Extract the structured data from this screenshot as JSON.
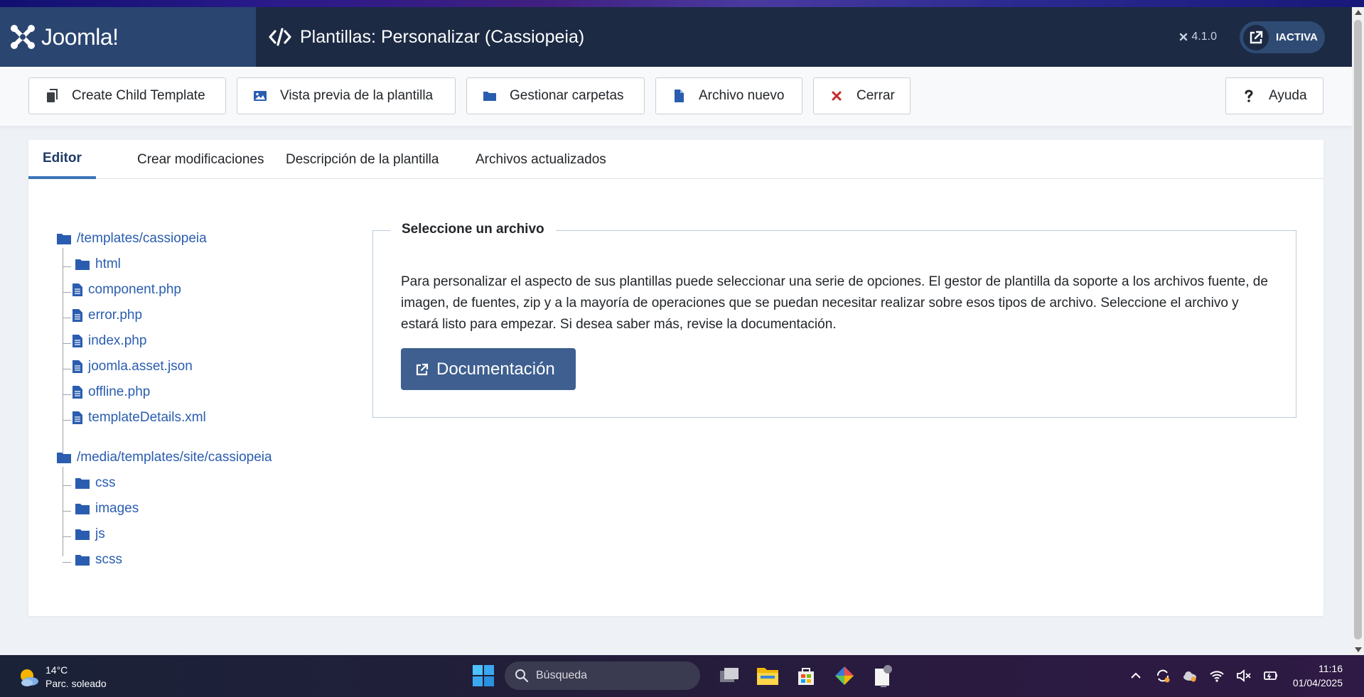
{
  "header": {
    "logo_text": "Joomla!",
    "title": "Plantillas: Personalizar (Cassiopeia)",
    "version": "4.1.0",
    "user_label": "IACTIVA"
  },
  "toolbar": {
    "create_child": "Create Child Template",
    "preview": "Vista previa de la plantilla",
    "manage_folders": "Gestionar carpetas",
    "new_file": "Archivo nuevo",
    "close": "Cerrar",
    "help": "Ayuda"
  },
  "tabs": [
    "Editor",
    "Crear modificaciones",
    "Descripción de la plantilla",
    "Archivos actualizados"
  ],
  "tree": {
    "root1": "/templates/cassiopeia",
    "root1_items": [
      {
        "type": "folder",
        "name": "html"
      },
      {
        "type": "file",
        "name": "component.php"
      },
      {
        "type": "file",
        "name": "error.php"
      },
      {
        "type": "file",
        "name": "index.php"
      },
      {
        "type": "file",
        "name": "joomla.asset.json"
      },
      {
        "type": "file",
        "name": "offline.php"
      },
      {
        "type": "file",
        "name": "templateDetails.xml"
      }
    ],
    "root2": "/media/templates/site/cassiopeia",
    "root2_items": [
      {
        "type": "folder",
        "name": "css"
      },
      {
        "type": "folder",
        "name": "images"
      },
      {
        "type": "folder",
        "name": "js"
      },
      {
        "type": "folder",
        "name": "scss"
      }
    ]
  },
  "select_file": {
    "legend": "Seleccione un archivo",
    "text": "Para personalizar el aspecto de sus plantillas puede seleccionar una serie de opciones. El gestor de plantilla da soporte a los archivos fuente, de imagen, de fuentes, zip y a la mayoría de operaciones que se puedan necesitar realizar sobre esos tipos de archivo. Seleccione el archivo y estará listo para empezar. Si desea saber más, revise la documentación.",
    "doc_button": "Documentación"
  },
  "taskbar": {
    "temperature": "14°C",
    "weather": "Parc. soleado",
    "search_placeholder": "Búsqueda",
    "time": "11:16",
    "date": "01/04/2025"
  },
  "colors": {
    "header_bg": "#1c2a44",
    "logo_bg": "#2a4570",
    "link": "#2a5db0",
    "doc_button": "#3e5f8f",
    "close_icon": "#c62828"
  }
}
